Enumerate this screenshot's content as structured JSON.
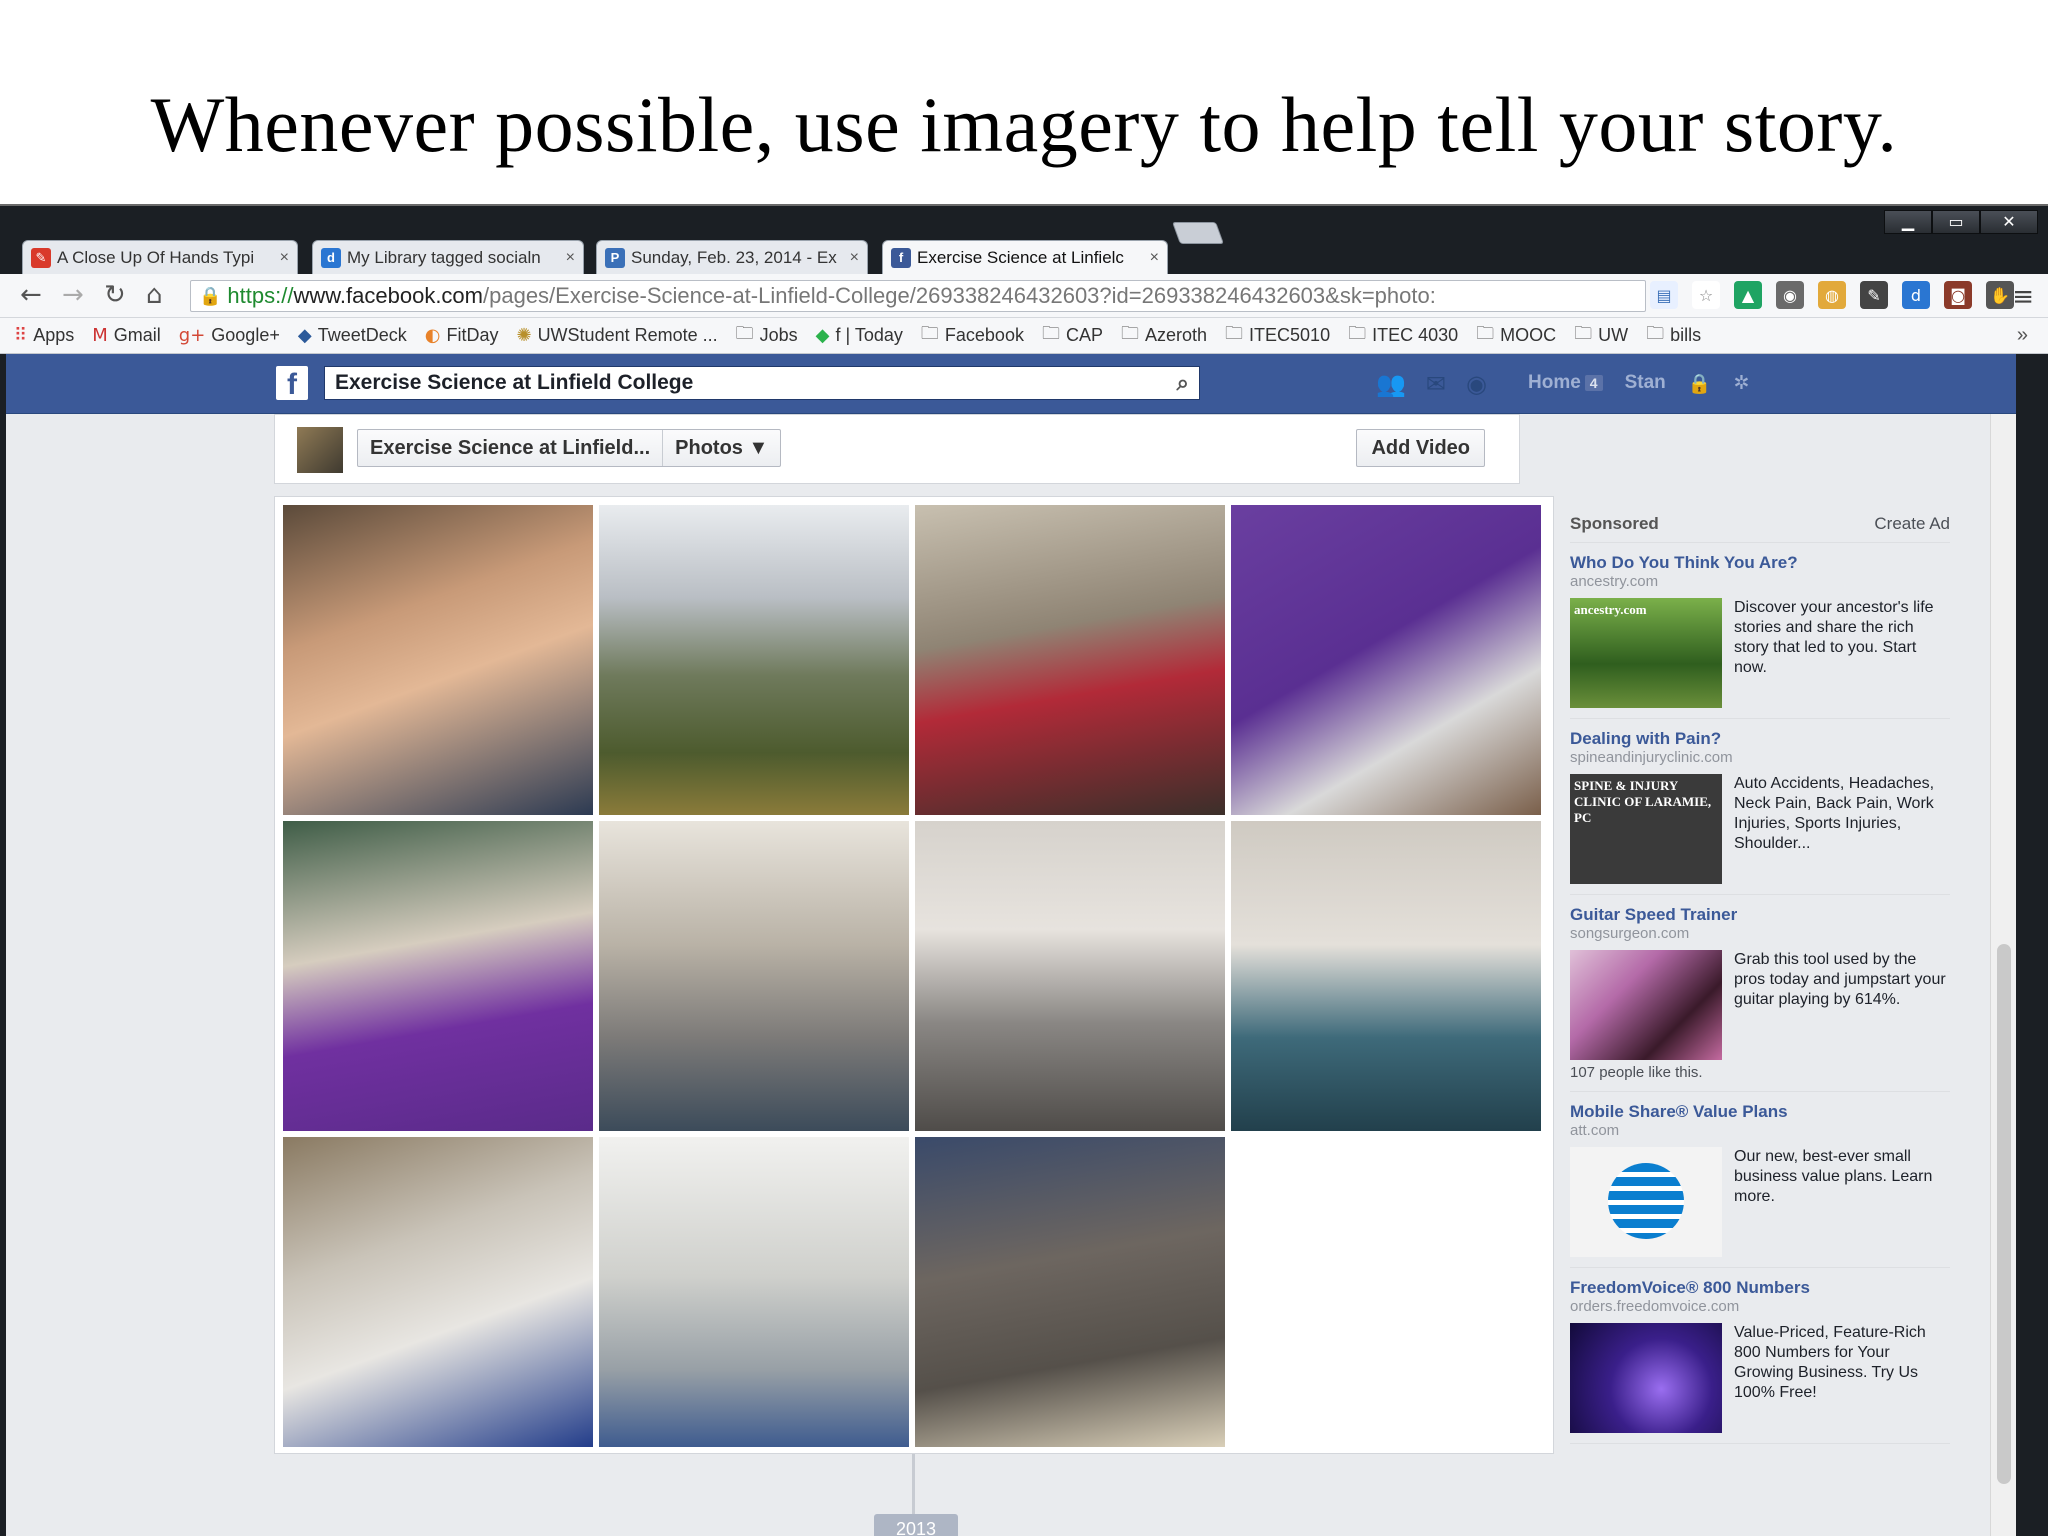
{
  "slide": {
    "title": "Whenever possible, use imagery to help tell your story."
  },
  "browser": {
    "window_buttons": {
      "minimize": "▁",
      "maximize": "▭",
      "close": "✕"
    },
    "tabs": [
      {
        "label": "A Close Up Of Hands Typi",
        "close": "×",
        "icon": "red-app-icon",
        "color": "#d93a2b",
        "glyph": "✎"
      },
      {
        "label": "My Library tagged socialn",
        "close": "×",
        "icon": "diigo-icon",
        "color": "#2a76d2",
        "glyph": "d"
      },
      {
        "label": "Sunday, Feb. 23, 2014 - Ex",
        "close": "×",
        "icon": "document-icon",
        "color": "#3b70b8",
        "glyph": "P"
      },
      {
        "label": "Exercise Science at Linfielc",
        "close": "×",
        "icon": "facebook-icon",
        "color": "#3b5998",
        "glyph": "f",
        "active": true
      }
    ],
    "address": {
      "scheme": "https://",
      "host": "www.facebook.com",
      "path": "/pages/Exercise-Science-at-Linfield-College/269338246432603?id=269338246432603&sk=photo:"
    },
    "bookmarks": [
      {
        "label": "Apps",
        "icon": "apps-grid-icon",
        "glyph": "⠿",
        "color": "#d44"
      },
      {
        "label": "Gmail",
        "icon": "gmail-icon",
        "glyph": "M",
        "color": "#c33"
      },
      {
        "label": "Google+",
        "icon": "google-plus-icon",
        "glyph": "g+",
        "color": "#d34836"
      },
      {
        "label": "TweetDeck",
        "icon": "tweetdeck-icon",
        "glyph": "◆",
        "color": "#2c5a9a"
      },
      {
        "label": "FitDay",
        "icon": "fitday-icon",
        "glyph": "◐",
        "color": "#e8822a"
      },
      {
        "label": "UWStudent Remote ...",
        "icon": "uw-icon",
        "glyph": "✺",
        "color": "#b8902a"
      },
      {
        "label": "Jobs",
        "icon": "folder-icon",
        "glyph": "🗀",
        "color": "#555"
      },
      {
        "label": "f | Today",
        "icon": "feedly-icon",
        "glyph": "◆",
        "color": "#2bb24c"
      },
      {
        "label": "Facebook",
        "icon": "folder-icon",
        "glyph": "🗀",
        "color": "#555"
      },
      {
        "label": "CAP",
        "icon": "folder-icon",
        "glyph": "🗀",
        "color": "#555"
      },
      {
        "label": "Azeroth",
        "icon": "folder-icon",
        "glyph": "🗀",
        "color": "#555"
      },
      {
        "label": "ITEC5010",
        "icon": "folder-icon",
        "glyph": "🗀",
        "color": "#555"
      },
      {
        "label": "ITEC 4030",
        "icon": "folder-icon",
        "glyph": "🗀",
        "color": "#555"
      },
      {
        "label": "MOOC",
        "icon": "folder-icon",
        "glyph": "🗀",
        "color": "#555"
      },
      {
        "label": "UW",
        "icon": "folder-icon",
        "glyph": "🗀",
        "color": "#555"
      },
      {
        "label": "bills",
        "icon": "folder-icon",
        "glyph": "🗀",
        "color": "#555"
      }
    ],
    "bookmarks_more": "»"
  },
  "facebook": {
    "search_value": "Exercise Science at Linfield College",
    "nav": {
      "home": "Home",
      "home_count": "4",
      "user": "Stan"
    },
    "page_selector": {
      "page": "Exercise Science at Linfield...",
      "section": "Photos ▼"
    },
    "add_video": "Add Video",
    "year": "2013",
    "photos": [
      {
        "name": "photo-man-portrait",
        "bg": "linear-gradient(160deg,#5b4a3a 0%,#c89a78 35%,#e3b896 55%,#2c3a52 100%)"
      },
      {
        "name": "photo-mountain-hiker",
        "bg": "linear-gradient(180deg,#e9ecef 0%,#b9bec4 30%,#6f7a5c 55%,#4d5b2e 80%,#8a7b3a 100%)"
      },
      {
        "name": "photo-fair-booth",
        "bg": "linear-gradient(170deg,#c8c0b0 0%,#8f8474 40%,#b22a38 60%,#3b2f2a 100%)"
      },
      {
        "name": "photo-purple-table-equipment",
        "bg": "linear-gradient(150deg,#6a3fa0 0%,#5a2f92 45%,#d9d9d9 70%,#7a5f4a 100%)"
      },
      {
        "name": "photo-booth-volunteers",
        "bg": "linear-gradient(170deg,#3f5d47 0%,#d6cdbf 40%,#7030a0 65%,#5a2b8a 100%)"
      },
      {
        "name": "photo-lift-demo",
        "bg": "linear-gradient(180deg,#e8e4dc 0%,#b9b2a6 40%,#7c7a78 70%,#3c4b5a 100%)"
      },
      {
        "name": "photo-tank-lift",
        "bg": "linear-gradient(180deg,#d6d2cc 0%,#e7e3de 35%,#8a8784 65%,#4f4c49 100%)"
      },
      {
        "name": "photo-water-tank-student",
        "bg": "linear-gradient(180deg,#cfcac2 0%,#e4e0da 40%,#3e6a7a 70%,#22404c 100%)"
      },
      {
        "name": "photo-student-scrubs",
        "bg": "linear-gradient(160deg,#8a7a62 0%,#c9c3b8 35%,#e8e6e2 60%,#233d8a 100%)"
      },
      {
        "name": "photo-xray-view",
        "bg": "linear-gradient(180deg,#f1f1ef 0%,#cfd0cc 45%,#98a0a6 75%,#3f5c8f 100%)"
      },
      {
        "name": "photo-skeleton-floor",
        "bg": "linear-gradient(170deg,#3a4a6a 0%,#6d6660 40%,#55504a 70%,#d9cfb8 100%)"
      }
    ],
    "ads": {
      "sponsored": "Sponsored",
      "create_ad": "Create Ad",
      "items": [
        {
          "title": "Who Do You Think You Are?",
          "domain": "ancestry.com",
          "text": "Discover your ancestor's life stories and share the rich story that led to you. Start now.",
          "img_label": "ancestry.com",
          "likes": "",
          "bg": "linear-gradient(180deg,#7bb04a 0%,#2f5e1e 60%,#6a8f3a 100%)"
        },
        {
          "title": "Dealing with Pain?",
          "domain": "spineandinjuryclinic.com",
          "text": "Auto Accidents, Headaches, Neck Pain, Back Pain, Work Injuries, Sports Injuries, Shoulder...",
          "img_label": "SPINE & INJURY CLINIC OF LARAMIE, PC",
          "likes": "",
          "bg": "#3a3a3a"
        },
        {
          "title": "Guitar Speed Trainer",
          "domain": "songsurgeon.com",
          "text": "Grab this tool used by the pros today and jumpstart your guitar playing by 614%.",
          "img_label": "",
          "likes": "107 people like this.",
          "bg": "linear-gradient(135deg,#e0c0d8 0%,#b46aa8 35%,#3a1a2a 70%,#c46aa0 100%)"
        },
        {
          "title": "Mobile Share® Value Plans",
          "domain": "att.com",
          "text": "Our new, best-ever small business value plans. Learn more.",
          "img_label": "",
          "likes": "",
          "bg": "#f3f3f3"
        },
        {
          "title": "FreedomVoice® 800 Numbers",
          "domain": "orders.freedomvoice.com",
          "text": "Value-Priced, Feature-Rich 800 Numbers for Your Growing Business. Try Us 100% Free!",
          "img_label": "",
          "likes": "",
          "bg": "radial-gradient(circle at 60% 60%,#9a6ef0 0%,#3a1f8a 45%,#120a3a 100%)"
        }
      ]
    }
  }
}
